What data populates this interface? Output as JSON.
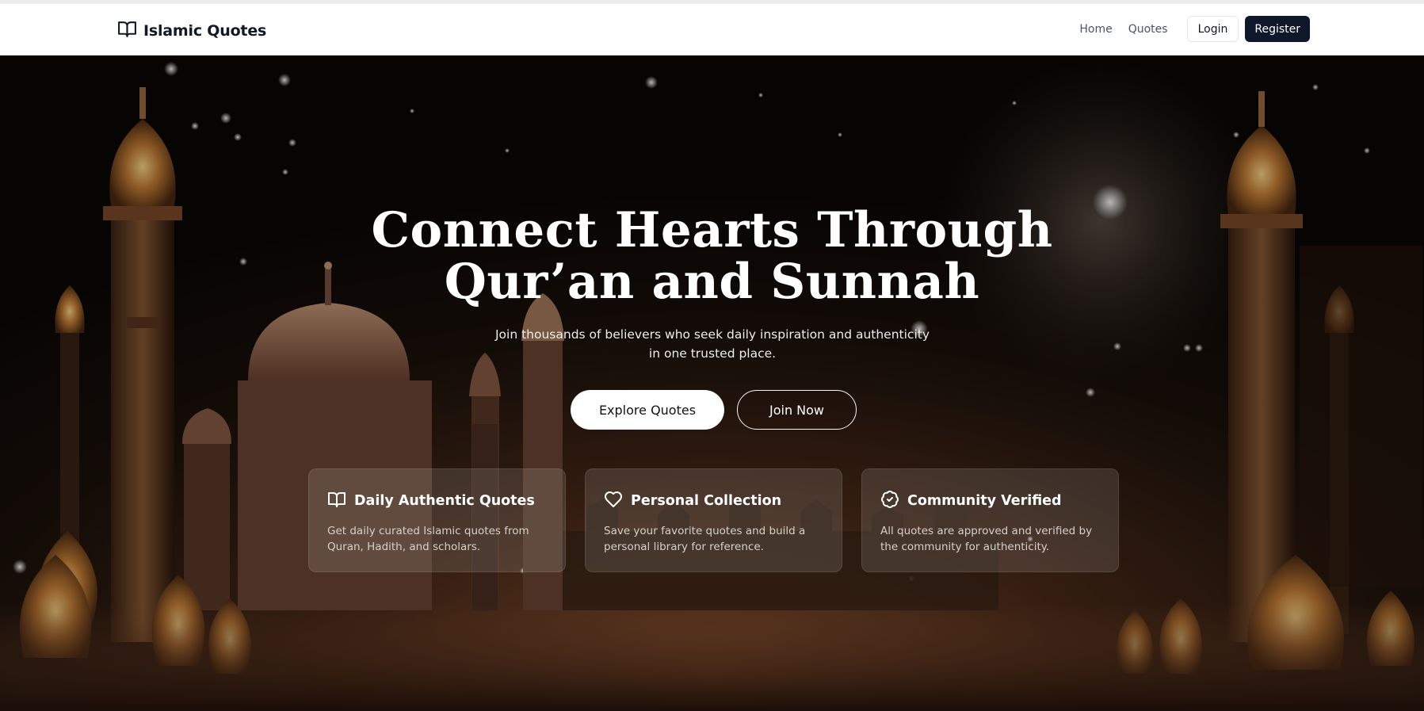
{
  "navbar": {
    "brand": {
      "icon": "open-book-icon",
      "name": "Islamic Quotes"
    },
    "links": [
      {
        "label": "Home"
      },
      {
        "label": "Quotes"
      }
    ],
    "login_label": "Login",
    "register_label": "Register"
  },
  "hero": {
    "title_line1": "Connect Hearts Through",
    "title_line2": "Qur’an and Sunnah",
    "subtitle": "Join thousands of believers who seek daily inspiration and authenticity in one trusted place.",
    "explore_label": "Explore Quotes",
    "join_label": "Join Now"
  },
  "features": [
    {
      "icon": "open-book-icon",
      "title": "Daily Authentic Quotes",
      "text": "Get daily curated Islamic quotes from Quran, Hadith, and scholars."
    },
    {
      "icon": "heart-icon",
      "title": "Personal Collection",
      "text": "Save your favorite quotes and build a personal library for reference."
    },
    {
      "icon": "badge-check-icon",
      "title": "Community Verified",
      "text": "All quotes are approved and verified by the community for authenticity."
    }
  ],
  "colors": {
    "navbar_bg": "#ffffff",
    "register_bg": "#0f172a",
    "hero_dark": "#0b0806",
    "hero_glow": "#a86b3a",
    "text_light": "#ffffff"
  }
}
